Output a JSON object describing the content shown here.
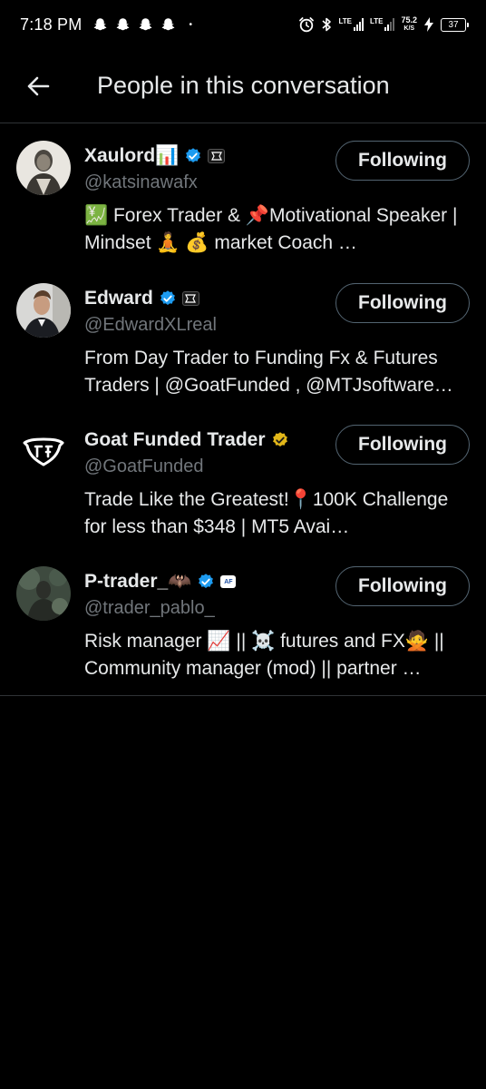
{
  "status_bar": {
    "time": "7:18 PM",
    "notification_icons": [
      "snapchat-icon",
      "snapchat-icon",
      "snapchat-icon",
      "snapchat-icon"
    ],
    "dot": "•",
    "network_1": "LTE",
    "network_2": "LTE",
    "speed_value": "75.2",
    "speed_unit": "K/S",
    "battery": "37",
    "icons": [
      "alarm-icon",
      "bluetooth-icon",
      "signal-icon",
      "signal-icon",
      "charging-icon",
      "battery-icon"
    ]
  },
  "header": {
    "title": "People in this conversation",
    "back_icon": "arrow-left-icon"
  },
  "colors": {
    "background": "#000000",
    "text": "#e7e9ea",
    "secondary_text": "#71767b",
    "divider": "#2f3336",
    "verified_blue": "#1d9bf0",
    "verified_gold": "#e2b719"
  },
  "users": [
    {
      "display_name": "Xaulord📊",
      "handle": "@katsinawafx",
      "verified": "blue",
      "affiliate_badge": "GFT",
      "bio": "💹 Forex Trader & 📌Motivational Speaker | Mindset 🧘 💰 market Coach …",
      "button_label": "Following"
    },
    {
      "display_name": "Edward",
      "handle": "@EdwardXLreal",
      "verified": "blue",
      "affiliate_badge": "GFT",
      "bio": "From Day Trader to Funding Fx & Futures Traders | @GoatFunded , @MTJsoftware…",
      "button_label": "Following"
    },
    {
      "display_name": "Goat Funded Trader",
      "handle": "@GoatFunded",
      "verified": "gold",
      "affiliate_badge": "",
      "bio": "Trade Like the Greatest!📍100K Challenge for less than $348 | MT5 Avai…",
      "button_label": "Following"
    },
    {
      "display_name": "P-trader_🦇",
      "handle": "@trader_pablo_",
      "verified": "blue",
      "affiliate_badge": "AF",
      "bio": "Risk manager 📈 || ☠️ futures and FX🙅 || Community manager (mod) || partner …",
      "button_label": "Following"
    }
  ]
}
